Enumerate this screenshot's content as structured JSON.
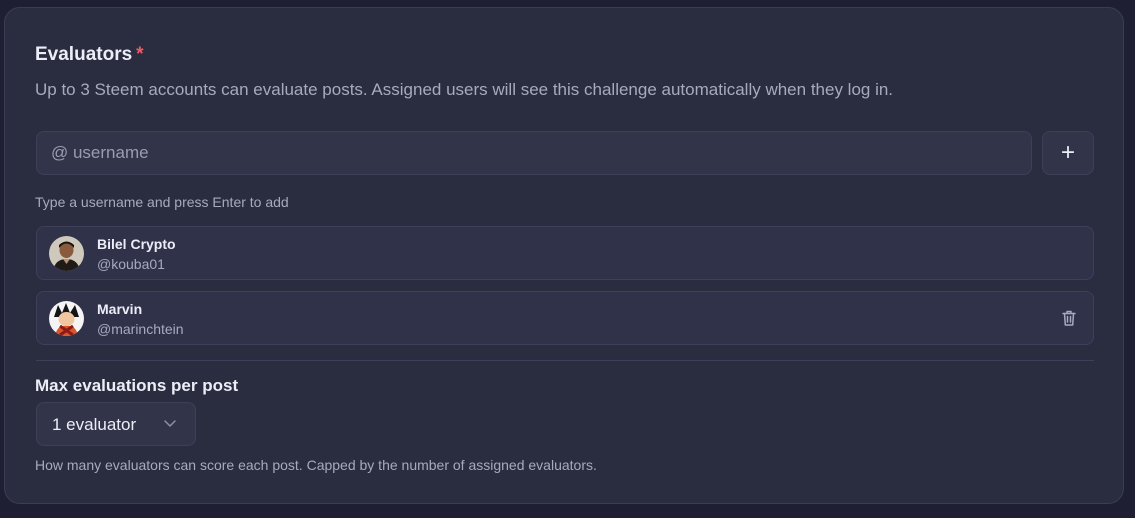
{
  "evaluators": {
    "title": "Evaluators",
    "required_mark": "*",
    "description": "Up to 3 Steem accounts can evaluate posts. Assigned users will see this challenge automatically when they log in.",
    "input_placeholder": "@ username",
    "add_label": "+",
    "hint": "Type a username and press Enter to add",
    "users": [
      {
        "name": "Bilel Crypto",
        "handle": "@kouba01",
        "avatar_icon": "avatar-photo",
        "removable": false
      },
      {
        "name": "Marvin",
        "handle": "@marinchtein",
        "avatar_icon": "avatar-anime",
        "removable": true
      }
    ]
  },
  "max_evaluations": {
    "title": "Max evaluations per post",
    "selected": "1 evaluator",
    "help": "How many evaluators can score each post. Capped by the number of assigned evaluators."
  },
  "colors": {
    "background": "#1e1f33",
    "card": "#2a2c40",
    "required": "#f05a62"
  }
}
